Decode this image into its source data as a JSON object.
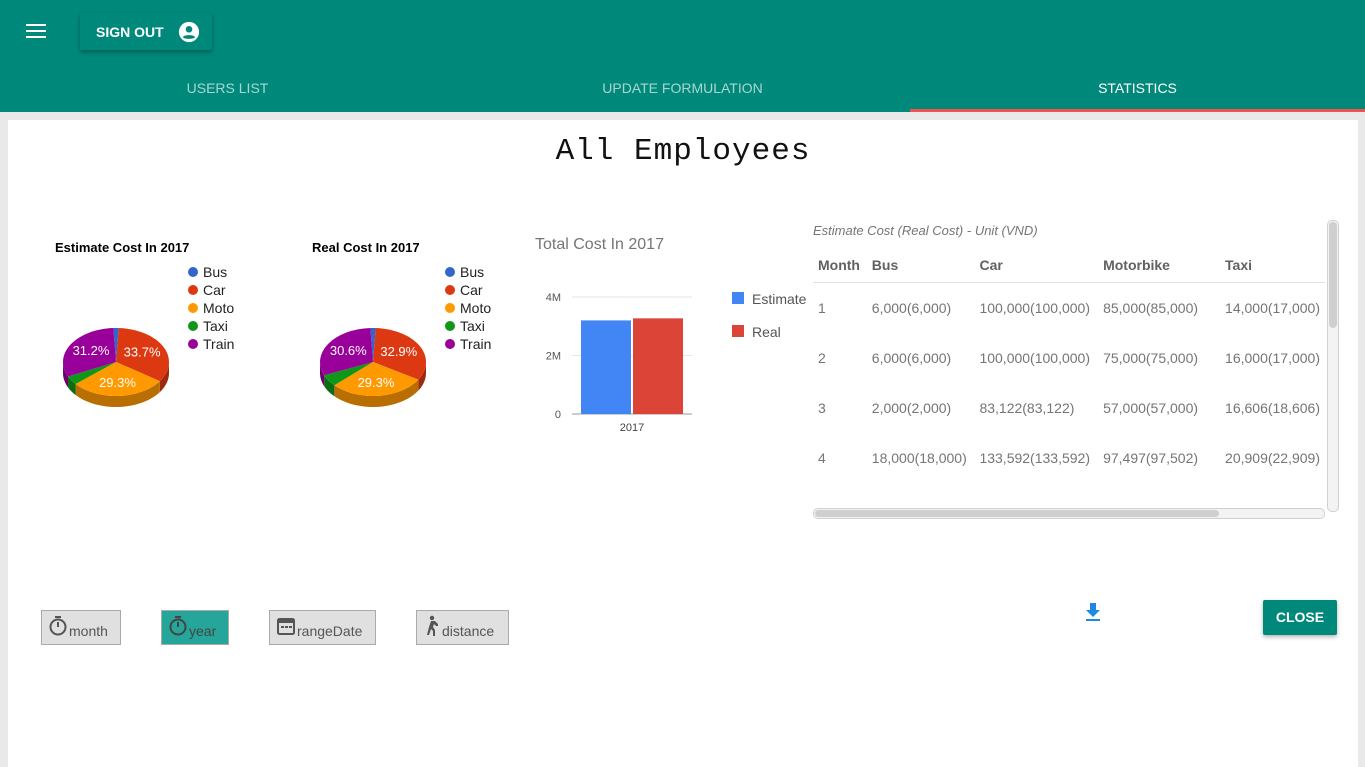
{
  "header": {
    "signout_label": "SIGN OUT",
    "tabs": [
      {
        "label": "USERS LIST"
      },
      {
        "label": "UPDATE FORMULATION"
      },
      {
        "label": "STATISTICS",
        "active": true
      }
    ],
    "colors": {
      "appbar": "#00897b",
      "indicator": "#ef5350"
    }
  },
  "page_title": "All Employees",
  "chart_data": [
    {
      "type": "pie",
      "title": "Estimate Cost In 2017",
      "labels": [
        "Bus",
        "Car",
        "Moto",
        "Taxi",
        "Train"
      ],
      "values": [
        1.6,
        33.7,
        29.3,
        4.2,
        31.2
      ],
      "colors": [
        "#3366cc",
        "#dc3912",
        "#ff9900",
        "#109618",
        "#990099"
      ],
      "slice_labels": [
        "",
        "33.7%",
        "29.3%",
        "",
        "31.2%"
      ],
      "legend": "right",
      "style": "3d"
    },
    {
      "type": "pie",
      "title": "Real Cost In 2017",
      "labels": [
        "Bus",
        "Car",
        "Moto",
        "Taxi",
        "Train"
      ],
      "values": [
        1.6,
        32.9,
        29.3,
        5.6,
        30.6
      ],
      "colors": [
        "#3366cc",
        "#dc3912",
        "#ff9900",
        "#109618",
        "#990099"
      ],
      "slice_labels": [
        "",
        "32.9%",
        "29.3%",
        "",
        "30.6%"
      ],
      "legend": "right",
      "style": "3d"
    },
    {
      "type": "bar",
      "title": "Total Cost In 2017",
      "categories": [
        "2017"
      ],
      "series": [
        {
          "name": "Estimate",
          "values": [
            3200000
          ],
          "color": "#4285f4"
        },
        {
          "name": "Real",
          "values": [
            3270000
          ],
          "color": "#db4437"
        }
      ],
      "ylim": [
        0,
        4000000
      ],
      "yticks": [
        {
          "value": 0,
          "label": "0"
        },
        {
          "value": 2000000,
          "label": "2M"
        },
        {
          "value": 4000000,
          "label": "4M"
        }
      ],
      "grid": true,
      "legend": "right"
    }
  ],
  "table": {
    "caption": "Estimate Cost (Real Cost) - Unit (VND)",
    "columns": [
      "Month",
      "Bus",
      "Car",
      "Motorbike",
      "Taxi"
    ],
    "rows": [
      [
        "1",
        "6,000(6,000)",
        "100,000(100,000)",
        "85,000(85,000)",
        "14,000(17,000)"
      ],
      [
        "2",
        "6,000(6,000)",
        "100,000(100,000)",
        "75,000(75,000)",
        "16,000(17,000)"
      ],
      [
        "3",
        "2,000(2,000)",
        "83,122(83,122)",
        "57,000(57,000)",
        "16,606(18,606)"
      ],
      [
        "4",
        "18,000(18,000)",
        "133,592(133,592)",
        "97,497(97,502)",
        "20,909(22,909)"
      ]
    ]
  },
  "filters": [
    {
      "label": "month",
      "icon": "timer-icon",
      "active": false
    },
    {
      "label": "year",
      "icon": "timer-icon",
      "active": true
    },
    {
      "label": "rangeDate",
      "icon": "calendar-icon",
      "active": false
    },
    {
      "label": "distance",
      "icon": "walk-icon",
      "active": false
    }
  ],
  "close_label": "CLOSE",
  "download_icon": "download-icon"
}
